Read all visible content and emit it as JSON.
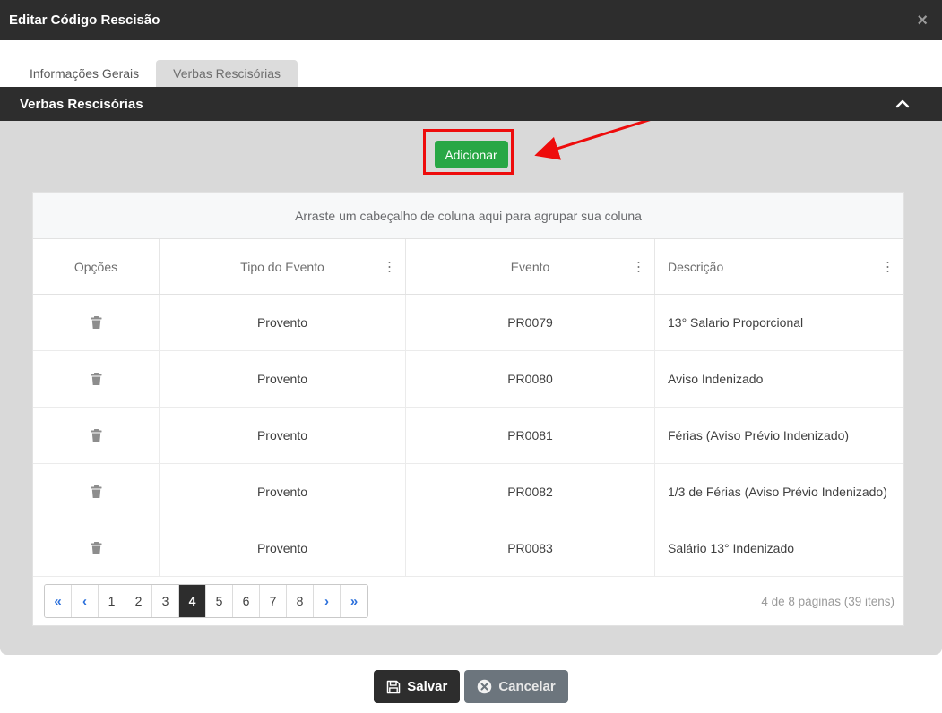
{
  "modal": {
    "title": "Editar Código Rescisão",
    "close_icon": "×"
  },
  "tabs": [
    {
      "label": "Informações Gerais",
      "active": false
    },
    {
      "label": "Verbas Rescisórias",
      "active": true
    }
  ],
  "panel": {
    "title": "Verbas Rescisórias"
  },
  "toolbar": {
    "add_label": "Adicionar"
  },
  "grid": {
    "group_hint": "Arraste um cabeçalho de coluna aqui para agrupar sua coluna",
    "columns": [
      "Opções",
      "Tipo do Evento",
      "Evento",
      "Descrição"
    ],
    "menu_icon": "⋮",
    "rows": [
      {
        "tipo": "Provento",
        "evento": "PR0079",
        "descricao": "13° Salario Proporcional"
      },
      {
        "tipo": "Provento",
        "evento": "PR0080",
        "descricao": "Aviso Indenizado"
      },
      {
        "tipo": "Provento",
        "evento": "PR0081",
        "descricao": "Férias (Aviso Prévio Indenizado)"
      },
      {
        "tipo": "Provento",
        "evento": "PR0082",
        "descricao": "1/3 de Férias (Aviso Prévio Indenizado)"
      },
      {
        "tipo": "Provento",
        "evento": "PR0083",
        "descricao": "Salário 13° Indenizado"
      }
    ],
    "pager": {
      "first": "«",
      "prev": "‹",
      "next": "›",
      "last": "»",
      "pages": [
        "1",
        "2",
        "3",
        "4",
        "5",
        "6",
        "7",
        "8"
      ],
      "active_page": "4",
      "info": "4 de 8 páginas (39 itens)"
    }
  },
  "footer": {
    "save_label": "Salvar",
    "cancel_label": "Cancelar"
  },
  "colors": {
    "header_dark": "#2d2d2d",
    "accent_green": "#28a745",
    "annotation_red": "#ee0c0c",
    "pager_blue": "#2a6fdb",
    "cancel_grey": "#6c757d"
  }
}
